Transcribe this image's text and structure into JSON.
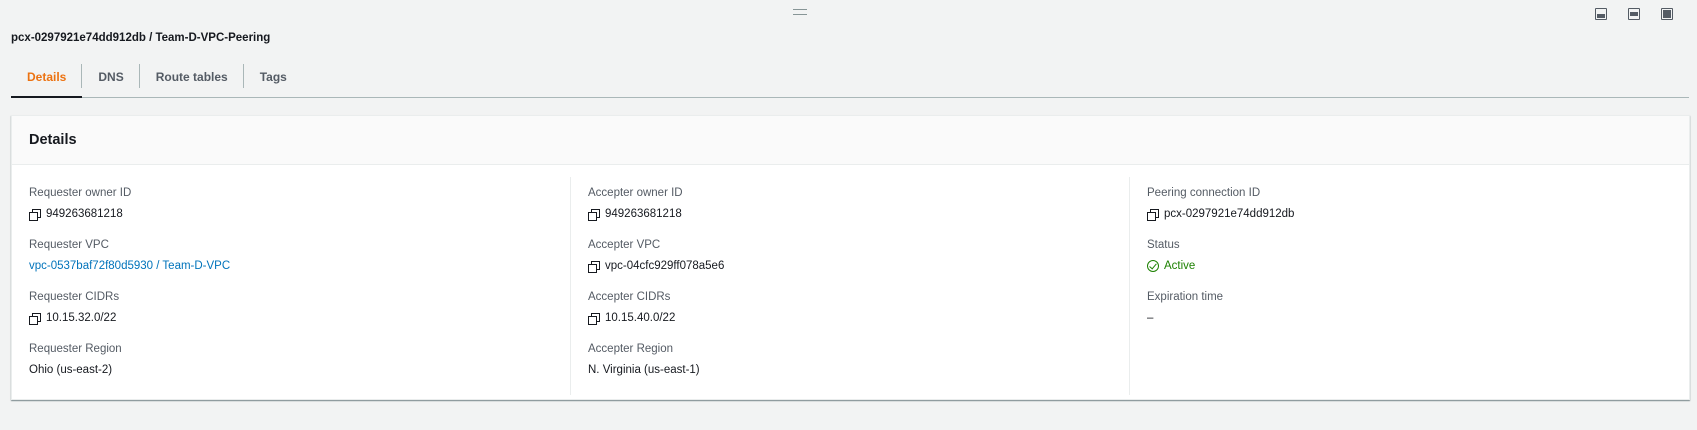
{
  "page_title": "pcx-0297921e74dd912db / Team-D-VPC-Peering",
  "tabs": [
    {
      "label": "Details",
      "active": true
    },
    {
      "label": "DNS",
      "active": false
    },
    {
      "label": "Route tables",
      "active": false
    },
    {
      "label": "Tags",
      "active": false
    }
  ],
  "card": {
    "title": "Details",
    "col1": {
      "requester_owner_id": {
        "label": "Requester owner ID",
        "value": "949263681218"
      },
      "requester_vpc": {
        "label": "Requester VPC",
        "value": "vpc-0537baf72f80d5930 / Team-D-VPC"
      },
      "requester_cidrs": {
        "label": "Requester CIDRs",
        "value": "10.15.32.0/22"
      },
      "requester_region": {
        "label": "Requester Region",
        "value": "Ohio (us-east-2)"
      }
    },
    "col2": {
      "accepter_owner_id": {
        "label": "Accepter owner ID",
        "value": "949263681218"
      },
      "accepter_vpc": {
        "label": "Accepter VPC",
        "value": "vpc-04cfc929ff078a5e6"
      },
      "accepter_cidrs": {
        "label": "Accepter CIDRs",
        "value": "10.15.40.0/22"
      },
      "accepter_region": {
        "label": "Accepter Region",
        "value": "N. Virginia (us-east-1)"
      }
    },
    "col3": {
      "peering_connection_id": {
        "label": "Peering connection ID",
        "value": "pcx-0297921e74dd912db"
      },
      "status": {
        "label": "Status",
        "value": "Active"
      },
      "expiration_time": {
        "label": "Expiration time",
        "value": "–"
      }
    }
  },
  "colors": {
    "accent": "#ec7211",
    "link": "#0073bb",
    "success": "#1d8102",
    "background": "#f2f3f3"
  },
  "icons": {
    "copy": "copy-icon",
    "status": "check-circle-icon",
    "panels": [
      "panel-bottom-icon",
      "panel-side-icon",
      "panel-full-icon"
    ]
  }
}
